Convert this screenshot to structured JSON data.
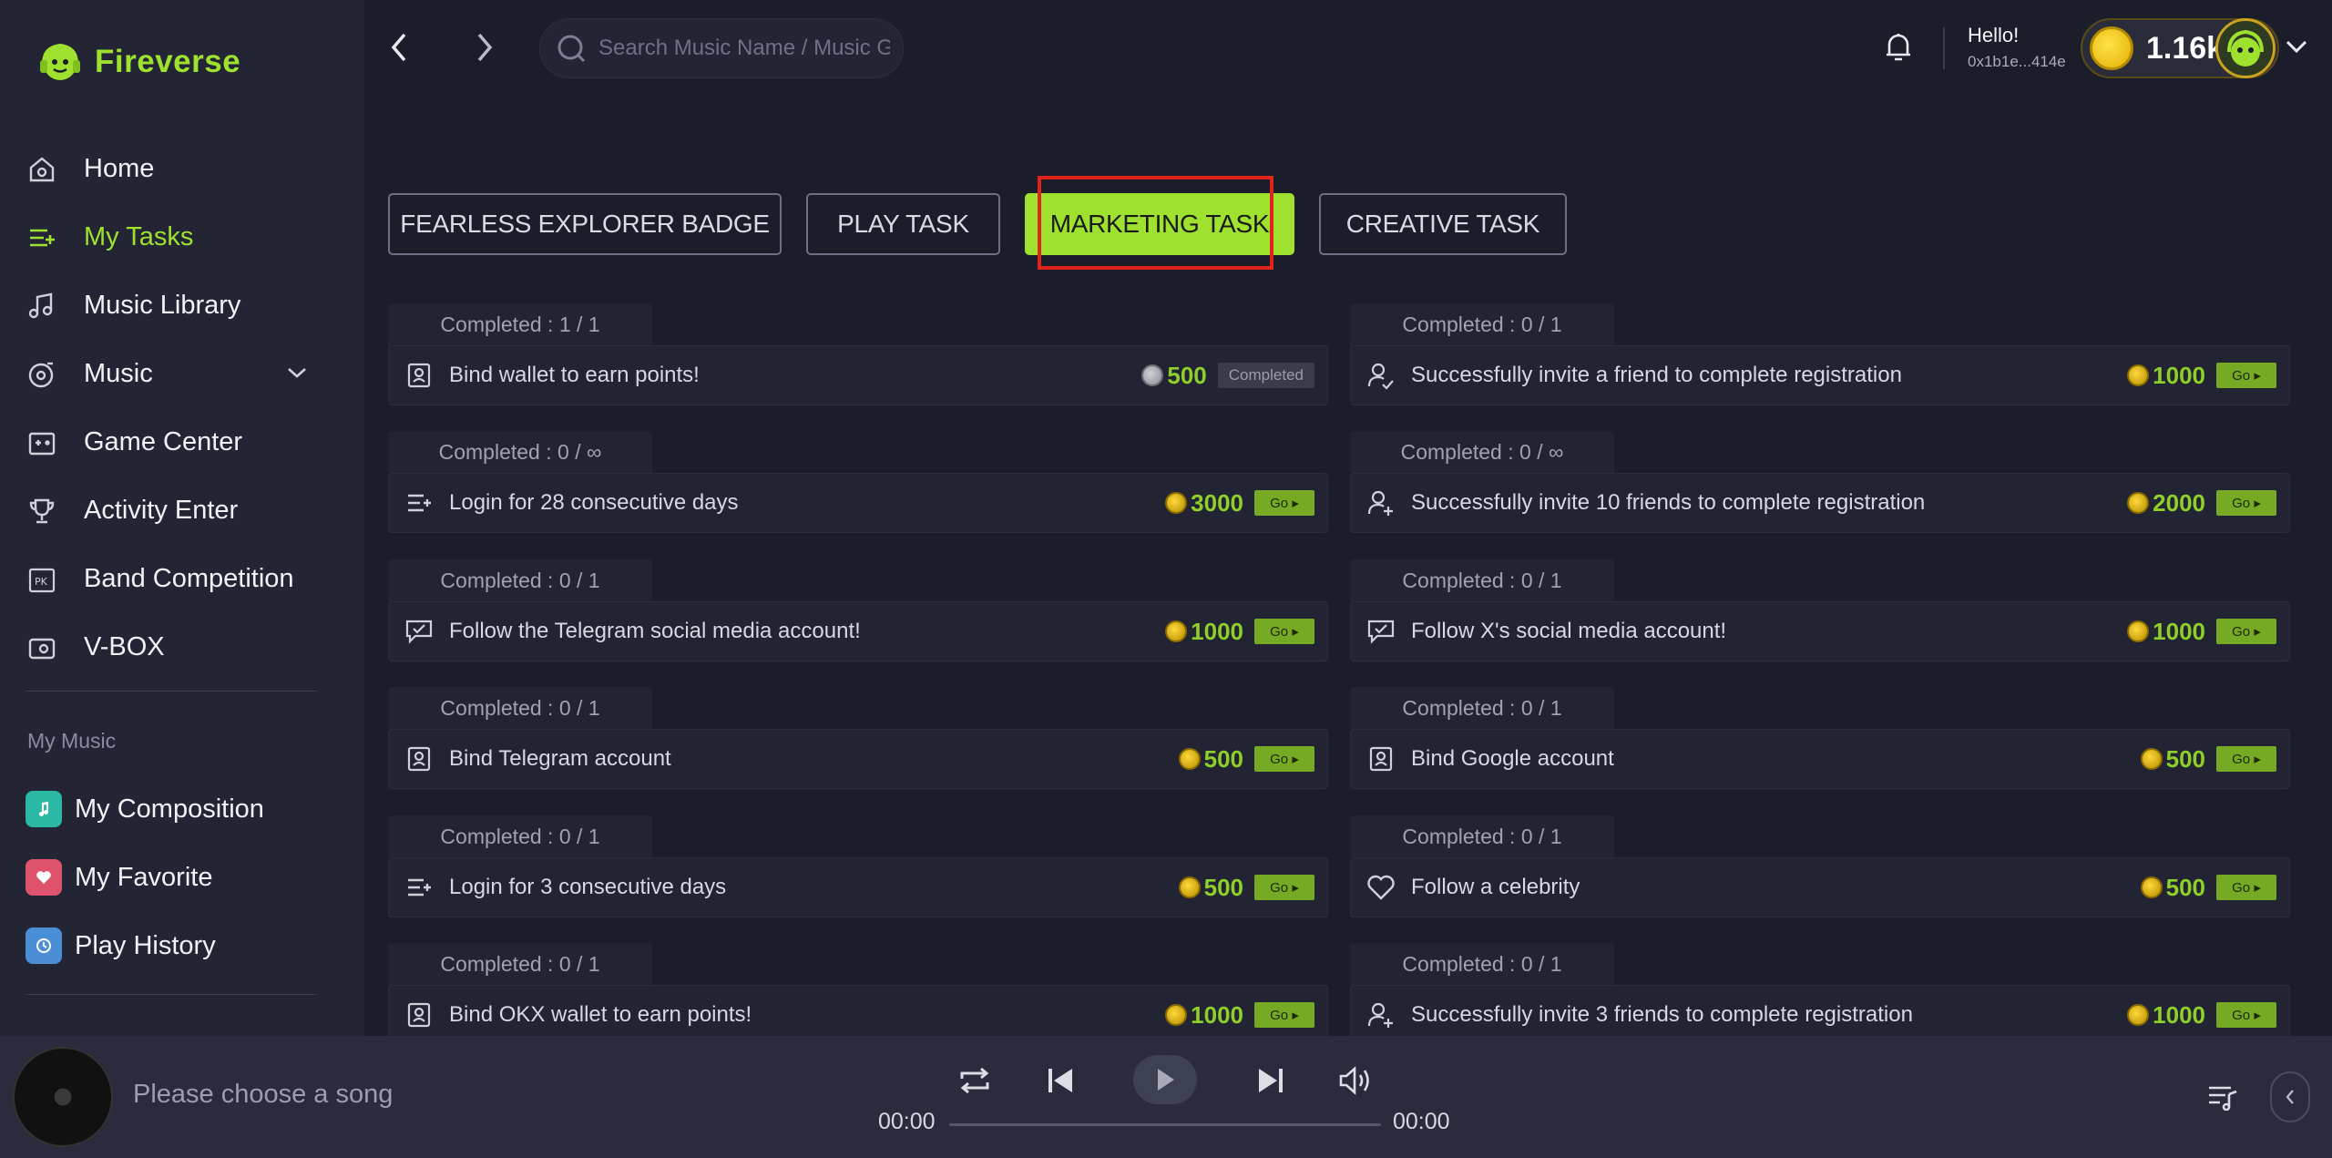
{
  "brand": {
    "name": "Fireverse"
  },
  "nav": [
    {
      "label": "Home",
      "icon": "home-icon"
    },
    {
      "label": "My Tasks",
      "icon": "tasks-icon"
    },
    {
      "label": "Music Library",
      "icon": "music-note-icon"
    },
    {
      "label": "Music",
      "icon": "music-disc-icon"
    },
    {
      "label": "Game Center",
      "icon": "game-icon"
    },
    {
      "label": "Activity Enter",
      "icon": "trophy-icon"
    },
    {
      "label": "Band Competition",
      "icon": "pk-icon"
    },
    {
      "label": "V-BOX",
      "icon": "vbox-icon"
    }
  ],
  "my_music": {
    "title": "My Music",
    "items": [
      {
        "label": "My Composition",
        "icon": "composition-icon",
        "color": "#2bb9a6"
      },
      {
        "label": "My Favorite",
        "icon": "heart-icon",
        "color": "#e0536c"
      },
      {
        "label": "Play History",
        "icon": "history-icon",
        "color": "#4a8fd6"
      }
    ]
  },
  "search": {
    "placeholder": "Search Music Name / Music Genre"
  },
  "user": {
    "greeting": "Hello!",
    "address": "0x1b1e...414e",
    "points": "1.16k"
  },
  "tabs": [
    {
      "label": "FEARLESS EXPLORER BADGE",
      "active": false
    },
    {
      "label": "PLAY TASK",
      "active": false
    },
    {
      "label": "MARKETING TASK",
      "active": true
    },
    {
      "label": "CREATIVE TASK",
      "active": false
    }
  ],
  "tasks_left": [
    {
      "completed": "Completed : 1 / 1",
      "label": "Bind wallet to earn points!",
      "reward": "500",
      "status": "Completed",
      "icon": "id-card-icon"
    },
    {
      "completed": "Completed : 0 / ∞",
      "label": "Login for 28 consecutive days",
      "reward": "3000",
      "status": "Go ▸",
      "icon": "list-add-icon"
    },
    {
      "completed": "Completed : 0 / 1",
      "label": "Follow the Telegram social media account!",
      "reward": "1000",
      "status": "Go ▸",
      "icon": "chat-check-icon"
    },
    {
      "completed": "Completed : 0 / 1",
      "label": "Bind Telegram account",
      "reward": "500",
      "status": "Go ▸",
      "icon": "id-card-icon"
    },
    {
      "completed": "Completed : 0 / 1",
      "label": "Login for 3 consecutive days",
      "reward": "500",
      "status": "Go ▸",
      "icon": "list-add-icon"
    },
    {
      "completed": "Completed : 0 / 1",
      "label": "Bind OKX wallet to earn points!",
      "reward": "1000",
      "status": "Go ▸",
      "icon": "id-card-icon"
    }
  ],
  "tasks_right": [
    {
      "completed": "Completed : 0 / 1",
      "label": "Successfully invite a friend to complete registration",
      "reward": "1000",
      "status": "Go ▸",
      "icon": "user-check-icon"
    },
    {
      "completed": "Completed : 0 / ∞",
      "label": "Successfully invite 10 friends to complete registration",
      "reward": "2000",
      "status": "Go ▸",
      "icon": "user-add-icon"
    },
    {
      "completed": "Completed : 0 / 1",
      "label": "Follow X's social media account!",
      "reward": "1000",
      "status": "Go ▸",
      "icon": "chat-check-icon"
    },
    {
      "completed": "Completed : 0 / 1",
      "label": "Bind Google account",
      "reward": "500",
      "status": "Go ▸",
      "icon": "id-card-icon"
    },
    {
      "completed": "Completed : 0 / 1",
      "label": "Follow a celebrity",
      "reward": "500",
      "status": "Go ▸",
      "icon": "heart-outline-icon"
    },
    {
      "completed": "Completed : 0 / 1",
      "label": "Successfully invite 3 friends to complete registration",
      "reward": "1000",
      "status": "Go ▸",
      "icon": "user-add-icon"
    }
  ],
  "player": {
    "now_playing": "Please choose a song",
    "time_current": "00:00",
    "time_total": "00:00"
  },
  "colors": {
    "accent": "#9ee12f",
    "highlight": "#e0241b",
    "background": "#1b1d2a",
    "panel": "#232534"
  }
}
